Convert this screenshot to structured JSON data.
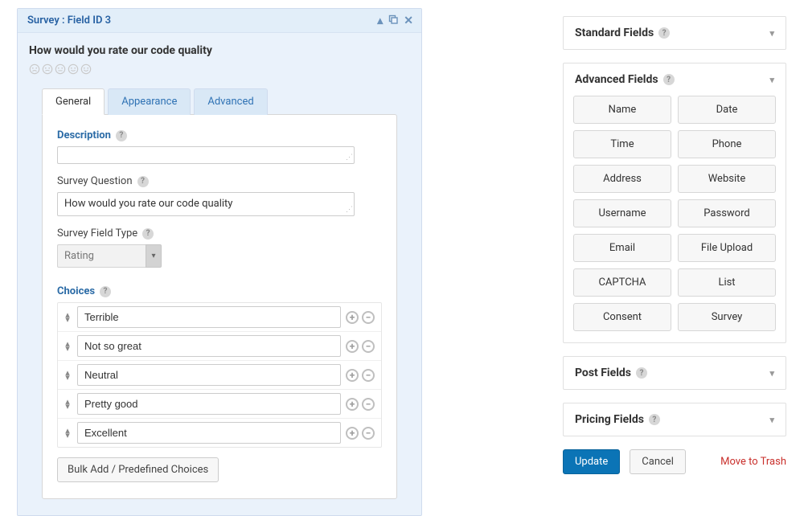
{
  "field_panel": {
    "title": "Survey : Field ID 3",
    "preview_title": "How would you rate our code quality",
    "tabs": {
      "general": "General",
      "appearance": "Appearance",
      "advanced": "Advanced"
    },
    "labels": {
      "description": "Description",
      "survey_question": "Survey Question",
      "survey_field_type": "Survey Field Type",
      "choices": "Choices"
    },
    "survey_question_value": "How would you rate our code quality",
    "field_type_value": "Rating",
    "choices": [
      {
        "label": "Terrible"
      },
      {
        "label": "Not so great"
      },
      {
        "label": "Neutral"
      },
      {
        "label": "Pretty good"
      },
      {
        "label": "Excellent"
      }
    ],
    "bulk_add_label": "Bulk Add / Predefined Choices"
  },
  "sidebar": {
    "panels": {
      "standard": "Standard Fields",
      "advanced": "Advanced Fields",
      "post": "Post Fields",
      "pricing": "Pricing Fields"
    },
    "advanced_fields": [
      "Name",
      "Date",
      "Time",
      "Phone",
      "Address",
      "Website",
      "Username",
      "Password",
      "Email",
      "File Upload",
      "CAPTCHA",
      "List",
      "Consent",
      "Survey"
    ],
    "actions": {
      "update": "Update",
      "cancel": "Cancel",
      "trash": "Move to Trash"
    }
  }
}
